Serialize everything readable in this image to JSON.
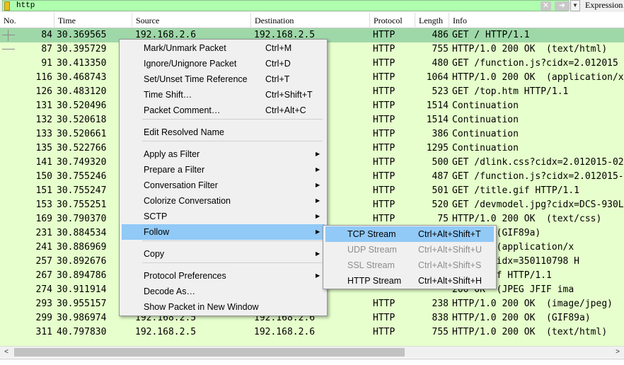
{
  "filter": {
    "value": "http",
    "expression_label": "Expression…",
    "clear_glyph": "✕",
    "apply_glyph": "➜",
    "dropdown_glyph": "▼",
    "bookmark_icon": "bookmark-icon"
  },
  "columns": {
    "no": "No.",
    "time": "Time",
    "source": "Source",
    "destination": "Destination",
    "protocol": "Protocol",
    "length": "Length",
    "info": "Info"
  },
  "packets": [
    {
      "no": "84",
      "time": "30.369565",
      "src": "192.168.2.6",
      "dst": "192.168.2.5",
      "proto": "HTTP",
      "len": "486",
      "info": "GET / HTTP/1.1"
    },
    {
      "no": "87",
      "time": "30.395729",
      "src": "",
      "dst": "",
      "proto": "HTTP",
      "len": "755",
      "info": "HTTP/1.0 200 OK  (text/html)"
    },
    {
      "no": "91",
      "time": "30.413350",
      "src": "",
      "dst": "",
      "proto": "HTTP",
      "len": "480",
      "info": "GET /function.js?cidx=2.012015"
    },
    {
      "no": "116",
      "time": "30.468743",
      "src": "",
      "dst": "",
      "proto": "HTTP",
      "len": "1064",
      "info": "HTTP/1.0 200 OK  (application/x"
    },
    {
      "no": "126",
      "time": "30.483120",
      "src": "",
      "dst": "",
      "proto": "HTTP",
      "len": "523",
      "info": "GET /top.htm HTTP/1.1"
    },
    {
      "no": "131",
      "time": "30.520496",
      "src": "",
      "dst": "",
      "proto": "HTTP",
      "len": "1514",
      "info": "Continuation"
    },
    {
      "no": "132",
      "time": "30.520618",
      "src": "",
      "dst": "",
      "proto": "HTTP",
      "len": "1514",
      "info": "Continuation"
    },
    {
      "no": "133",
      "time": "30.520661",
      "src": "",
      "dst": "",
      "proto": "HTTP",
      "len": "386",
      "info": "Continuation"
    },
    {
      "no": "135",
      "time": "30.522766",
      "src": "",
      "dst": "",
      "proto": "HTTP",
      "len": "1295",
      "info": "Continuation"
    },
    {
      "no": "141",
      "time": "30.749320",
      "src": "",
      "dst": "",
      "proto": "HTTP",
      "len": "500",
      "info": "GET /dlink.css?cidx=2.012015-02"
    },
    {
      "no": "150",
      "time": "30.755246",
      "src": "",
      "dst": "",
      "proto": "HTTP",
      "len": "487",
      "info": "GET /function.js?cidx=2.012015-"
    },
    {
      "no": "151",
      "time": "30.755247",
      "src": "",
      "dst": "",
      "proto": "HTTP",
      "len": "501",
      "info": "GET /title.gif HTTP/1.1"
    },
    {
      "no": "153",
      "time": "30.755251",
      "src": "",
      "dst": "",
      "proto": "HTTP",
      "len": "520",
      "info": "GET /devmodel.jpg?cidx=DCS-930L"
    },
    {
      "no": "169",
      "time": "30.790370",
      "src": "",
      "dst": "",
      "proto": "HTTP",
      "len": "75",
      "info": "HTTP/1.0 200 OK  (text/css)"
    },
    {
      "no": "231",
      "time": "30.884534",
      "src": "",
      "dst": "",
      "proto": "",
      "len": "",
      "info": "200 OK  (GIF89a)"
    },
    {
      "no": "241",
      "time": "30.886969",
      "src": "",
      "dst": "",
      "proto": "",
      "len": "",
      "info": "200 OK  (application/x"
    },
    {
      "no": "257",
      "time": "30.892676",
      "src": "",
      "dst": "",
      "proto": "",
      "len": "",
      "info": "ge.jpg?cidx=350110798 H"
    },
    {
      "no": "267",
      "time": "30.894786",
      "src": "",
      "dst": "",
      "proto": "",
      "len": "",
      "info": "urity.gif HTTP/1.1"
    },
    {
      "no": "274",
      "time": "30.911914",
      "src": "",
      "dst": "",
      "proto": "",
      "len": "",
      "info": "200 OK  (JPEG JFIF ima"
    },
    {
      "no": "293",
      "time": "30.955157",
      "src": "",
      "dst": "",
      "proto": "HTTP",
      "len": "238",
      "info": "HTTP/1.0 200 OK  (image/jpeg)"
    },
    {
      "no": "299",
      "time": "30.986974",
      "src": "192.168.2.5",
      "dst": "192.168.2.6",
      "proto": "HTTP",
      "len": "838",
      "info": "HTTP/1.0 200 OK  (GIF89a)"
    },
    {
      "no": "311",
      "time": "40.797830",
      "src": "192.168.2.5",
      "dst": "192.168.2.6",
      "proto": "HTTP",
      "len": "755",
      "info": "HTTP/1.0 200 OK  (text/html)"
    }
  ],
  "context_menu": {
    "items": [
      {
        "label": "Mark/Unmark Packet",
        "shortcut": "Ctrl+M"
      },
      {
        "label": "Ignore/Unignore Packet",
        "shortcut": "Ctrl+D"
      },
      {
        "label": "Set/Unset Time Reference",
        "shortcut": "Ctrl+T"
      },
      {
        "label": "Time Shift…",
        "shortcut": "Ctrl+Shift+T"
      },
      {
        "label": "Packet Comment…",
        "shortcut": "Ctrl+Alt+C"
      },
      {
        "label": "Edit Resolved Name",
        "shortcut": ""
      },
      {
        "label": "Apply as Filter",
        "shortcut": ""
      },
      {
        "label": "Prepare a Filter",
        "shortcut": ""
      },
      {
        "label": "Conversation Filter",
        "shortcut": ""
      },
      {
        "label": "Colorize Conversation",
        "shortcut": ""
      },
      {
        "label": "SCTP",
        "shortcut": ""
      },
      {
        "label": "Follow",
        "shortcut": ""
      },
      {
        "label": "Copy",
        "shortcut": ""
      },
      {
        "label": "Protocol Preferences",
        "shortcut": ""
      },
      {
        "label": "Decode As…",
        "shortcut": ""
      },
      {
        "label": "Show Packet in New Window",
        "shortcut": ""
      }
    ],
    "submenu_arrow": "▶"
  },
  "follow_submenu": {
    "items": [
      {
        "label": "TCP Stream",
        "shortcut": "Ctrl+Alt+Shift+T",
        "enabled": true
      },
      {
        "label": "UDP Stream",
        "shortcut": "Ctrl+Alt+Shift+U",
        "enabled": false
      },
      {
        "label": "SSL Stream",
        "shortcut": "Ctrl+Alt+Shift+S",
        "enabled": false
      },
      {
        "label": "HTTP Stream",
        "shortcut": "Ctrl+Alt+Shift+H",
        "enabled": true
      }
    ]
  },
  "scrollbar": {
    "left_glyph": "<",
    "right_glyph": ">"
  },
  "colors": {
    "row_bg": "#e6ffcc",
    "selected_row": "#9fd8a8",
    "filter_valid": "#afffaf",
    "menu_highlight": "#91c9f7"
  }
}
